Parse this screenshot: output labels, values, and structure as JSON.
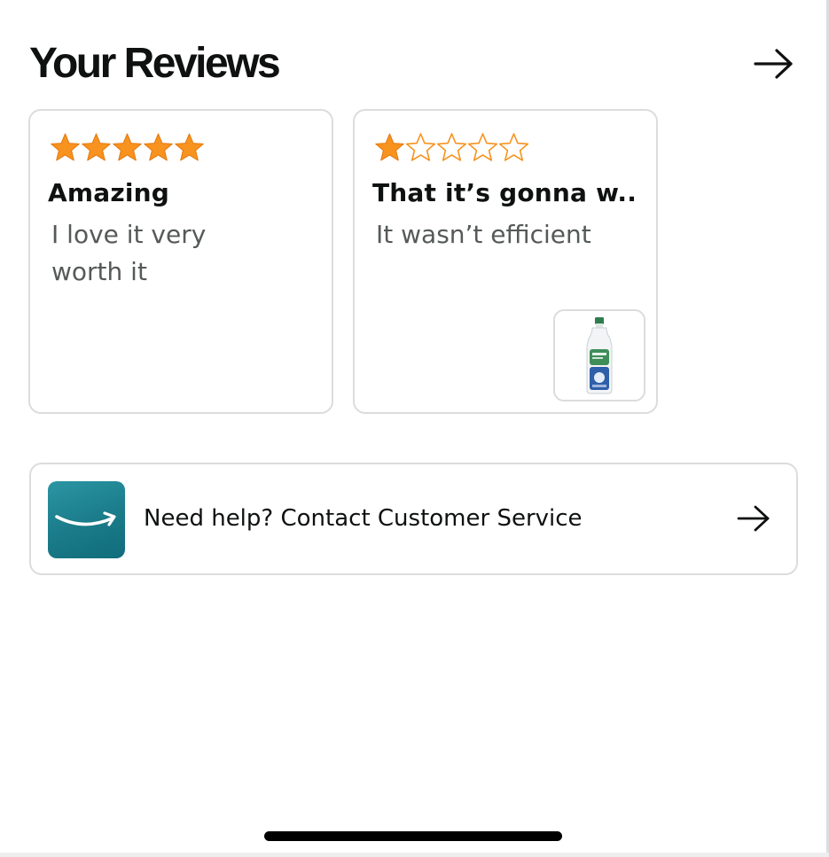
{
  "header": {
    "title": "Your Reviews",
    "arrow_icon": "arrow-right-icon"
  },
  "reviews": [
    {
      "rating": 5,
      "max_rating": 5,
      "title": "Amazing",
      "body": "I love it very worth it",
      "has_product_image": false
    },
    {
      "rating": 1,
      "max_rating": 5,
      "title": "That it’s gonna w...",
      "body": "It wasn’t efficient",
      "has_product_image": true,
      "product_image_icon": "dish-soap-bottle-icon"
    }
  ],
  "help": {
    "label": "Need help? Contact Customer Service",
    "logo_icon": "amazon-smile-logo-icon",
    "arrow_icon": "arrow-right-icon"
  },
  "colors": {
    "star_filled": "#f7931e",
    "star_outline": "#f7931e",
    "text_primary": "#0f1111",
    "text_secondary": "#565959",
    "card_border": "#dcdcdc",
    "logo_teal": "#1a7b89"
  }
}
